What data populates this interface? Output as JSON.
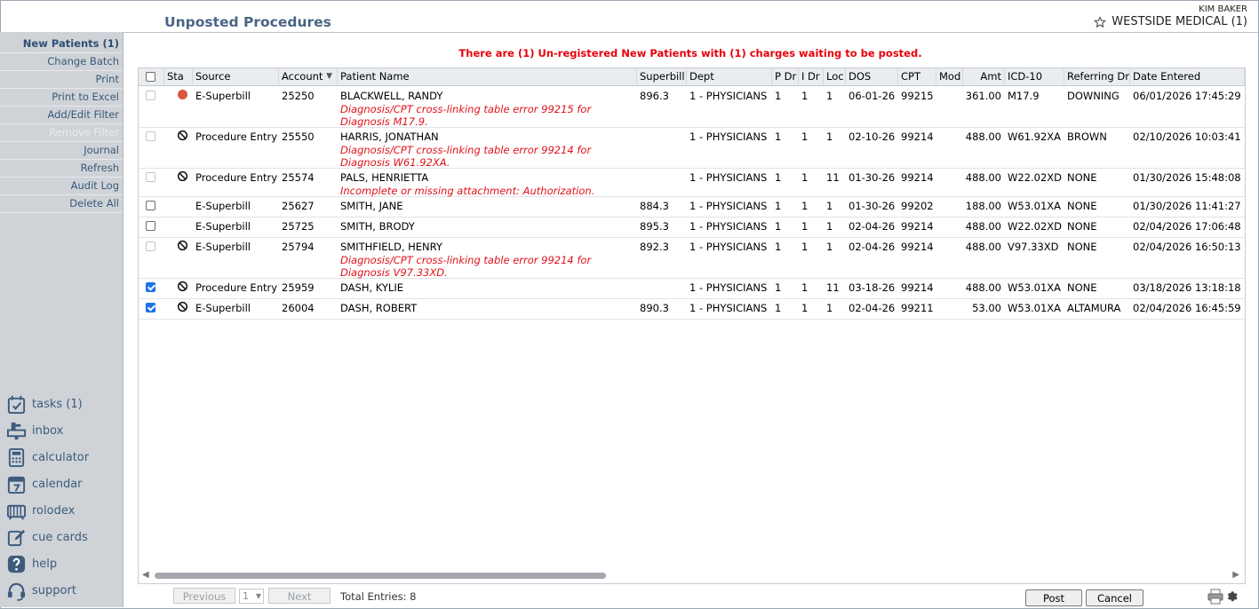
{
  "header": {
    "title": "Unposted Procedures",
    "user": "KIM BAKER",
    "practice": "WESTSIDE MEDICAL (1)"
  },
  "sidebar": {
    "items": [
      {
        "label": "New Patients (1)",
        "state": "active"
      },
      {
        "label": "Change Batch",
        "state": "normal"
      },
      {
        "label": "Print",
        "state": "normal"
      },
      {
        "label": "Print to Excel",
        "state": "normal"
      },
      {
        "label": "Add/Edit Filter",
        "state": "normal"
      },
      {
        "label": "Remove Filter",
        "state": "disabled"
      },
      {
        "label": "Journal",
        "state": "normal"
      },
      {
        "label": "Refresh",
        "state": "normal"
      },
      {
        "label": "Audit Log",
        "state": "normal"
      },
      {
        "label": "Delete All",
        "state": "normal"
      }
    ],
    "tools": [
      {
        "label": "tasks (1)",
        "icon": "tasks-icon"
      },
      {
        "label": "inbox",
        "icon": "inbox-icon"
      },
      {
        "label": "calculator",
        "icon": "calculator-icon"
      },
      {
        "label": "calendar",
        "icon": "calendar-icon"
      },
      {
        "label": "rolodex",
        "icon": "rolodex-icon"
      },
      {
        "label": "cue cards",
        "icon": "cue-cards-icon"
      },
      {
        "label": "help",
        "icon": "help-icon"
      },
      {
        "label": "support",
        "icon": "support-icon"
      }
    ]
  },
  "banner": "There are (1) Un-registered New Patients with (1) charges waiting to be posted.",
  "table": {
    "columns": [
      "Sta",
      "Source",
      "Account",
      "Patient Name",
      "Superbill",
      "Dept",
      "P Dr",
      "I Dr",
      "Loc",
      "DOS",
      "CPT",
      "Mod",
      "Amt",
      "ICD-10",
      "Referring Dr",
      "Date Entered"
    ],
    "rows": [
      {
        "checked": false,
        "enabled": false,
        "status": "dot",
        "source": "E-Superbill",
        "account": "25250",
        "patient": "BLACKWELL, RANDY",
        "superbill": "896.3",
        "dept": "1 - PHYSICIANS",
        "pdr": "1",
        "idr": "1",
        "loc": "1",
        "dos": "06-01-26",
        "cpt": "99215",
        "mod": "",
        "amt": "361.00",
        "icd": "M17.9",
        "ref": "DOWNING",
        "entered": "06/01/2026 17:45:29",
        "error": "Diagnosis/CPT cross-linking table error 99215 for Diagnosis M17.9."
      },
      {
        "checked": false,
        "enabled": false,
        "status": "no",
        "source": "Procedure Entry",
        "account": "25550",
        "patient": "HARRIS, JONATHAN",
        "superbill": "",
        "dept": "1 - PHYSICIANS",
        "pdr": "1",
        "idr": "1",
        "loc": "1",
        "dos": "02-10-26",
        "cpt": "99214",
        "mod": "",
        "amt": "488.00",
        "icd": "W61.92XA",
        "ref": "BROWN",
        "entered": "02/10/2026 10:03:41",
        "error": "Diagnosis/CPT cross-linking table error 99214 for Diagnosis W61.92XA."
      },
      {
        "checked": false,
        "enabled": false,
        "status": "no",
        "source": "Procedure Entry",
        "account": "25574",
        "patient": "PALS, HENRIETTA",
        "superbill": "",
        "dept": "1 - PHYSICIANS",
        "pdr": "1",
        "idr": "1",
        "loc": "11",
        "dos": "01-30-26",
        "cpt": "99214",
        "mod": "",
        "amt": "488.00",
        "icd": "W22.02XD",
        "ref": "NONE",
        "entered": "01/30/2026 15:48:08",
        "error": "Incomplete or missing attachment: Authorization."
      },
      {
        "checked": false,
        "enabled": true,
        "status": "",
        "source": "E-Superbill",
        "account": "25627",
        "patient": "SMITH, JANE",
        "superbill": "884.3",
        "dept": "1 - PHYSICIANS",
        "pdr": "1",
        "idr": "1",
        "loc": "1",
        "dos": "01-30-26",
        "cpt": "99202",
        "mod": "",
        "amt": "188.00",
        "icd": "W53.01XA",
        "ref": "NONE",
        "entered": "01/30/2026 11:41:27",
        "error": ""
      },
      {
        "checked": false,
        "enabled": true,
        "status": "",
        "source": "E-Superbill",
        "account": "25725",
        "patient": "SMITH, BRODY",
        "superbill": "895.3",
        "dept": "1 - PHYSICIANS",
        "pdr": "1",
        "idr": "1",
        "loc": "1",
        "dos": "02-04-26",
        "cpt": "99214",
        "mod": "",
        "amt": "488.00",
        "icd": "W22.02XD",
        "ref": "NONE",
        "entered": "02/04/2026 17:06:48",
        "error": ""
      },
      {
        "checked": false,
        "enabled": false,
        "status": "no",
        "source": "E-Superbill",
        "account": "25794",
        "patient": "SMITHFIELD, HENRY",
        "superbill": "892.3",
        "dept": "1 - PHYSICIANS",
        "pdr": "1",
        "idr": "1",
        "loc": "1",
        "dos": "02-04-26",
        "cpt": "99214",
        "mod": "",
        "amt": "488.00",
        "icd": "V97.33XD",
        "ref": "NONE",
        "entered": "02/04/2026 16:50:13",
        "error": "Diagnosis/CPT cross-linking table error 99214 for Diagnosis V97.33XD."
      },
      {
        "checked": true,
        "enabled": true,
        "status": "no",
        "source": "Procedure Entry",
        "account": "25959",
        "patient": "DASH, KYLIE",
        "superbill": "",
        "dept": "1 - PHYSICIANS",
        "pdr": "1",
        "idr": "1",
        "loc": "11",
        "dos": "03-18-26",
        "cpt": "99214",
        "mod": "",
        "amt": "488.00",
        "icd": "W53.01XA",
        "ref": "NONE",
        "entered": "03/18/2026 13:18:18",
        "error": ""
      },
      {
        "checked": true,
        "enabled": true,
        "status": "no",
        "source": "E-Superbill",
        "account": "26004",
        "patient": "DASH, ROBERT",
        "superbill": "890.3",
        "dept": "1 - PHYSICIANS",
        "pdr": "1",
        "idr": "1",
        "loc": "1",
        "dos": "02-04-26",
        "cpt": "99211",
        "mod": "",
        "amt": "53.00",
        "icd": "W53.01XA",
        "ref": "ALTAMURA",
        "entered": "02/04/2026 16:45:59",
        "error": ""
      }
    ]
  },
  "footer": {
    "previous": "Previous",
    "page": "1",
    "next": "Next",
    "total": "Total Entries: 8",
    "post": "Post",
    "cancel": "Cancel"
  }
}
